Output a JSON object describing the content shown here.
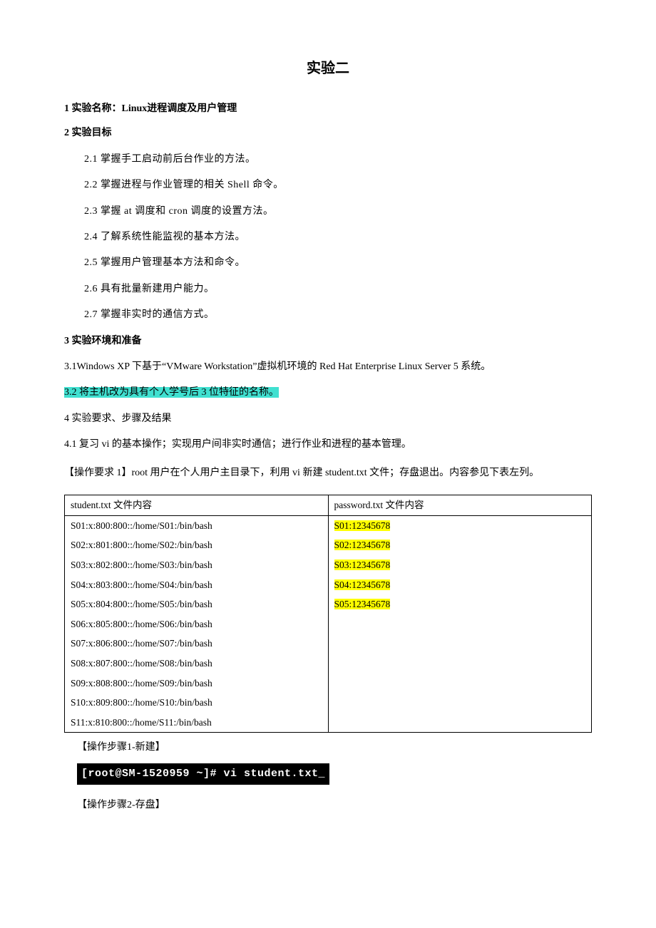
{
  "title": "实验二",
  "section1": "1 实验名称：Linux进程调度及用户管理",
  "section2": "2 实验目标",
  "goals": {
    "g1": "2.1 掌握手工启动前后台作业的方法。",
    "g2": "2.2 掌握进程与作业管理的相关 Shell 命令。",
    "g3": "2.3 掌握 at 调度和 cron 调度的设置方法。",
    "g4": "2.4 了解系统性能监视的基本方法。",
    "g5": "2.5 掌握用户管理基本方法和命令。",
    "g6": "2.6 具有批量新建用户能力。",
    "g7": "2.7 掌握非实时的通信方式。"
  },
  "section3": "3 实验环境和准备",
  "env1": "3.1Windows XP 下基于“VMware Workstation”虚拟机环境的 Red Hat Enterprise Linux Server 5 系统。",
  "env2": "3.2 将主机改为具有个人学号后 3 位特征的名称。",
  "section4": "4 实验要求、步骤及结果",
  "req41": "4.1 复习 vi 的基本操作；实现用户间非实时通信；进行作业和进程的基本管理。",
  "req_op1": "【操作要求 1】root 用户在个人用户主目录下，利用 vi 新建 student.txt 文件；存盘退出。内容参见下表左列。",
  "table": {
    "head_left": "student.txt 文件内容",
    "head_right": "password.txt 文件内容",
    "student_lines": [
      "S01:x:800:800::/home/S01:/bin/bash",
      "S02:x:801:800::/home/S02:/bin/bash",
      "S03:x:802:800::/home/S03:/bin/bash",
      "S04:x:803:800::/home/S04:/bin/bash",
      "S05:x:804:800::/home/S05:/bin/bash",
      "S06:x:805:800::/home/S06:/bin/bash",
      "S07:x:806:800::/home/S07:/bin/bash",
      "S08:x:807:800::/home/S08:/bin/bash",
      "S09:x:808:800::/home/S09:/bin/bash",
      "S10:x:809:800::/home/S10:/bin/bash",
      "S11:x:810:800::/home/S11:/bin/bash"
    ],
    "password_lines": [
      "S01:12345678",
      "S02:12345678",
      "S03:12345678",
      "S04:12345678",
      "S05:12345678"
    ]
  },
  "step1_label": "【操作步骤1-新建】",
  "terminal1": "[root@SM-1520959 ~]# vi student.txt_",
  "step2_label": "【操作步骤2-存盘】"
}
